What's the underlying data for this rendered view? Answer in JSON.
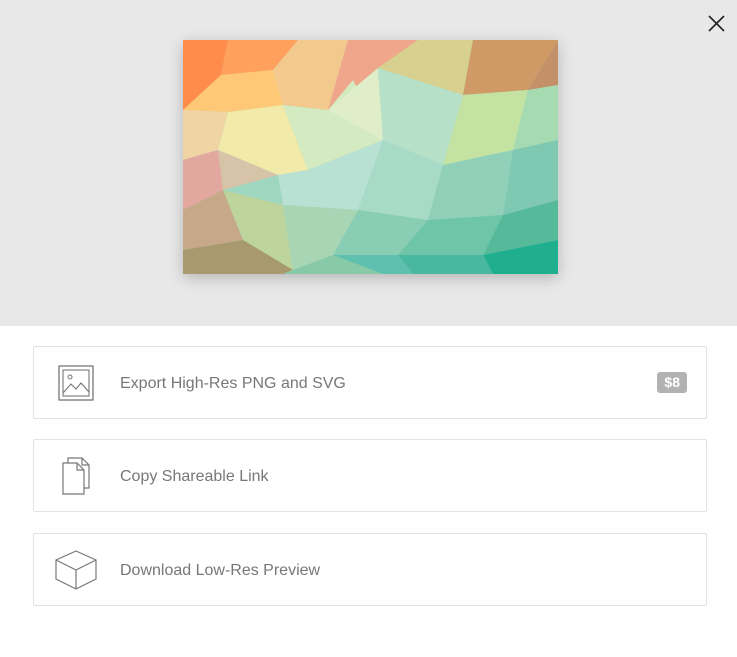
{
  "close_button": {
    "icon": "close-icon"
  },
  "artwork": {
    "description_icon": "low-poly-gradient-image",
    "colors": [
      "#ff8a4c",
      "#f0e8a8",
      "#bde0d4",
      "#8fd0b4",
      "#6cc3ad",
      "#1fae8f"
    ]
  },
  "options": [
    {
      "icon": "image-icon",
      "label": "Export High-Res PNG and SVG",
      "badge": "$8"
    },
    {
      "icon": "copy-pages-icon",
      "label": "Copy Shareable Link"
    },
    {
      "icon": "cube-icon",
      "label": "Download Low-Res Preview"
    }
  ],
  "colors": {
    "preview_background": "#e8e8e8",
    "label_text": "#777777",
    "badge_background": "#b2b2b2",
    "border": "#e3e3e3"
  }
}
